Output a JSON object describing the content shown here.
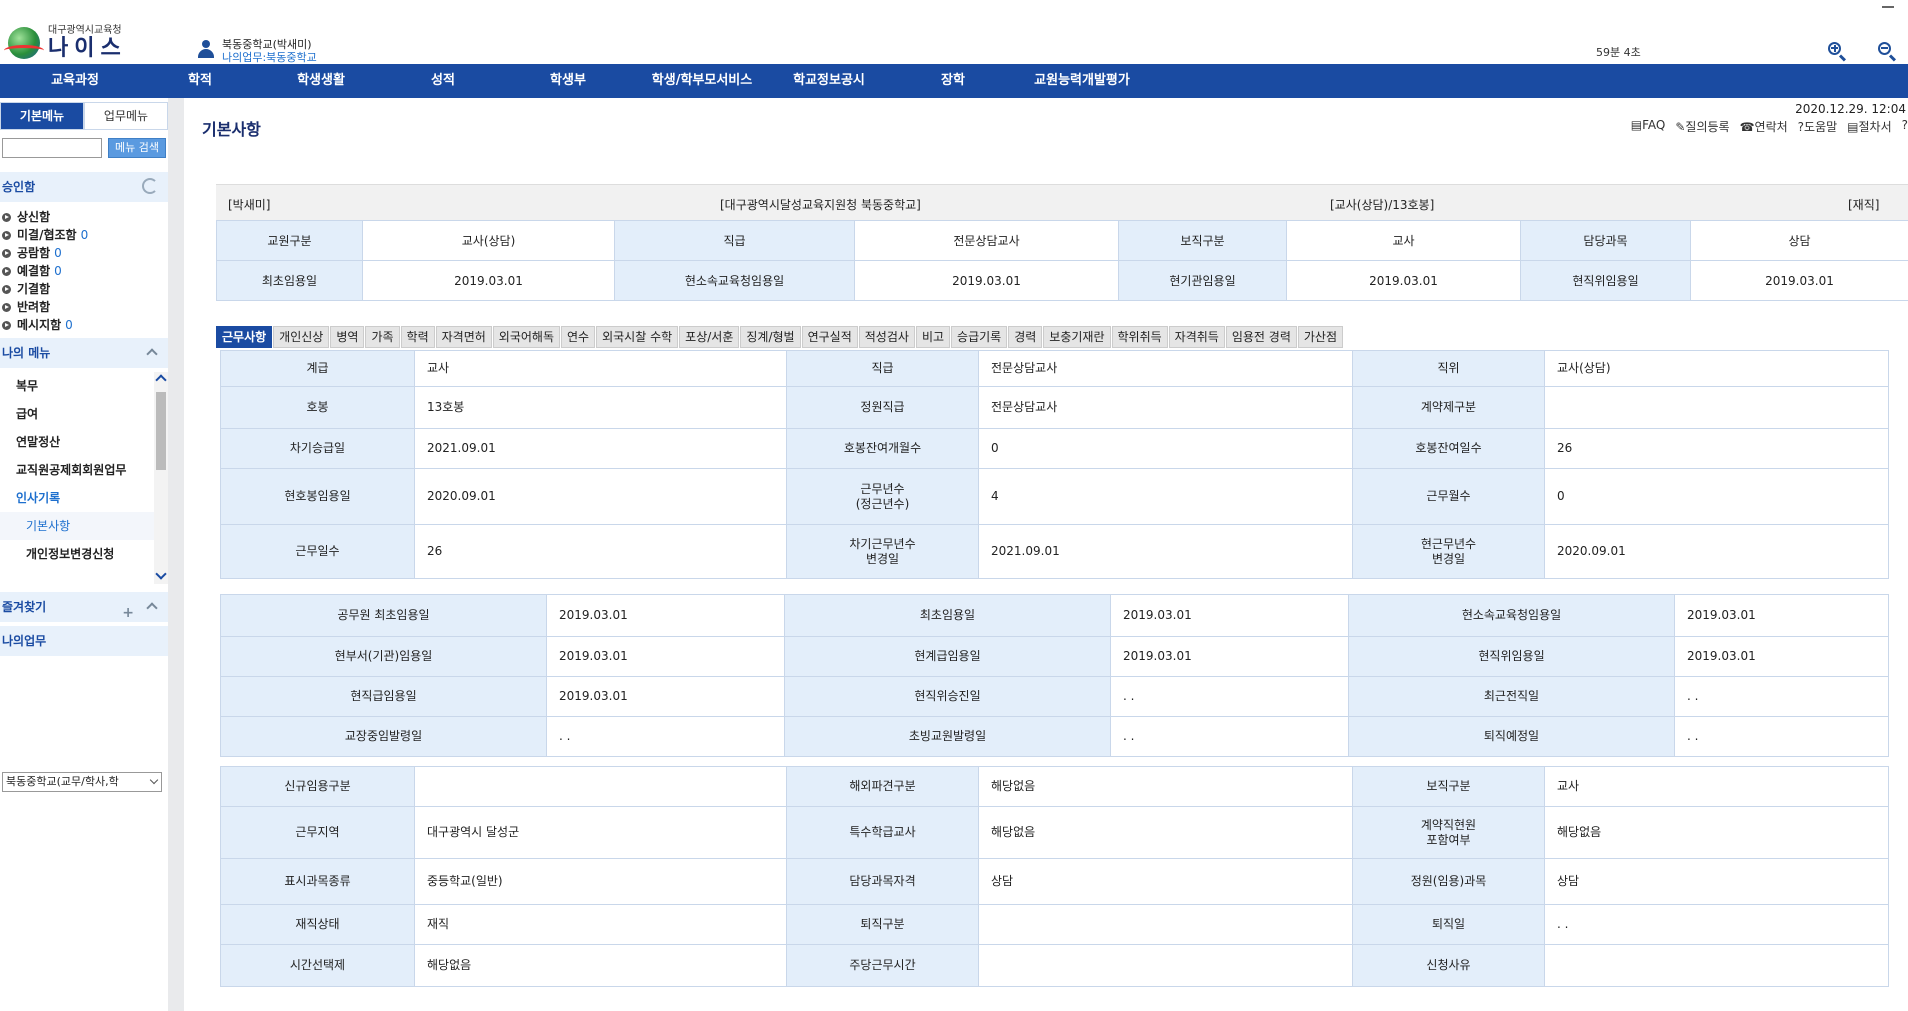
{
  "header": {
    "logo_sub": "대구광역시교육청",
    "logo_main": "나이스",
    "user_name": "북동중학교(박새미)",
    "user_work": "나의업무:북동중학교",
    "session": "59분 4초"
  },
  "nav": [
    "교육과정",
    "학적",
    "학생생활",
    "성적",
    "학생부",
    "학생/학부모서비스",
    "학교정보공시",
    "장학",
    "교원능력개발평가"
  ],
  "sidebar": {
    "tab_basic": "기본메뉴",
    "tab_work": "업무메뉴",
    "search_btn": "메뉴 검색",
    "approval_title": "승인함",
    "approvals": [
      {
        "label": "상신함",
        "count": ""
      },
      {
        "label": "미결/협조함",
        "count": "0"
      },
      {
        "label": "공람함",
        "count": "0"
      },
      {
        "label": "예결함",
        "count": "0"
      },
      {
        "label": "기결함",
        "count": ""
      },
      {
        "label": "반려함",
        "count": ""
      },
      {
        "label": "메시지함",
        "count": "0"
      }
    ],
    "my_menu_title": "나의 메뉴",
    "my_menu": [
      "복무",
      "급여",
      "연말정산",
      "교직원공제회회원업무",
      "인사기록"
    ],
    "sub_menu": [
      "기본사항",
      "개인정보변경신청"
    ],
    "fav_title": "즐겨찾기",
    "fav_plus": "+",
    "my_work_title": "나의업무",
    "school_select": "북동중학교(교무/학사,학"
  },
  "main": {
    "datetime": "2020.12.29. 12:04",
    "title": "기본사항",
    "toolbar": [
      "▤FAQ",
      "✎질의등록",
      "☎연락처",
      "?도움말",
      "▤절차서",
      "?"
    ],
    "summary": {
      "name": "[박새미]",
      "org": "[대구광역시달성교육지원청 북동중학교]",
      "rank": "[교사(상담)/13호봉]",
      "status": "[재직]"
    },
    "basic": [
      [
        "교원구분",
        "교사(상담)",
        "직급",
        "전문상담교사",
        "보직구분",
        "교사",
        "담당과목",
        "상담"
      ],
      [
        "최초임용일",
        "2019.03.01",
        "현소속교육청임용일",
        "2019.03.01",
        "현기관임용일",
        "2019.03.01",
        "현직위임용일",
        "2019.03.01"
      ]
    ],
    "tabs": [
      "근무사항",
      "개인신상",
      "병역",
      "가족",
      "학력",
      "자격면허",
      "외국어해독",
      "연수",
      "외국시찰 수학",
      "포상/서훈",
      "징계/형벌",
      "연구실적",
      "적성검사",
      "비고",
      "승급기록",
      "경력",
      "보충기재란",
      "학위취득",
      "자격취득",
      "임용전 경력",
      "가산점"
    ],
    "section1": [
      [
        "계급",
        "교사",
        "직급",
        "전문상담교사",
        "직위",
        "교사(상담)"
      ],
      [
        "호봉",
        "13호봉",
        "정원직급",
        "전문상담교사",
        "계약제구분",
        ""
      ],
      [
        "차기승급일",
        "2021.09.01",
        "호봉잔여개월수",
        "0",
        "호봉잔여일수",
        "26"
      ],
      [
        "현호봉임용일",
        "2020.09.01",
        "근무년수\n(정근년수)",
        "4",
        "근무월수",
        "0"
      ],
      [
        "근무일수",
        "26",
        "차기근무년수\n변경일",
        "2021.09.01",
        "현근무년수\n변경일",
        "2020.09.01"
      ]
    ],
    "section2": [
      [
        "공무원 최초임용일",
        "2019.03.01",
        "최초임용일",
        "2019.03.01",
        "현소속교육청임용일",
        "2019.03.01"
      ],
      [
        "현부서(기관)임용일",
        "2019.03.01",
        "현계급임용일",
        "2019.03.01",
        "현직위임용일",
        "2019.03.01"
      ],
      [
        "현직급임용일",
        "2019.03.01",
        "현직위승진일",
        ". .",
        "최근전직일",
        ". ."
      ],
      [
        "교장중임발령일",
        ". .",
        "초빙교원발령일",
        ". .",
        "퇴직예정일",
        ". ."
      ]
    ],
    "section3": [
      [
        "신규임용구분",
        "",
        "해외파견구분",
        "해당없음",
        "보직구분",
        "교사"
      ],
      [
        "근무지역",
        "대구광역시 달성군",
        "특수학급교사",
        "해당없음",
        "계약직현원\n포함여부",
        "해당없음"
      ],
      [
        "표시과목종류",
        "중등학교(일반)",
        "담당과목자격",
        "상담",
        "정원(임용)과목",
        "상담"
      ],
      [
        "재직상태",
        "재직",
        "퇴직구분",
        "",
        "퇴직일",
        ". ."
      ],
      [
        "시간선택제",
        "해당없음",
        "주당근무시간",
        "",
        "신청사유",
        ""
      ]
    ]
  }
}
